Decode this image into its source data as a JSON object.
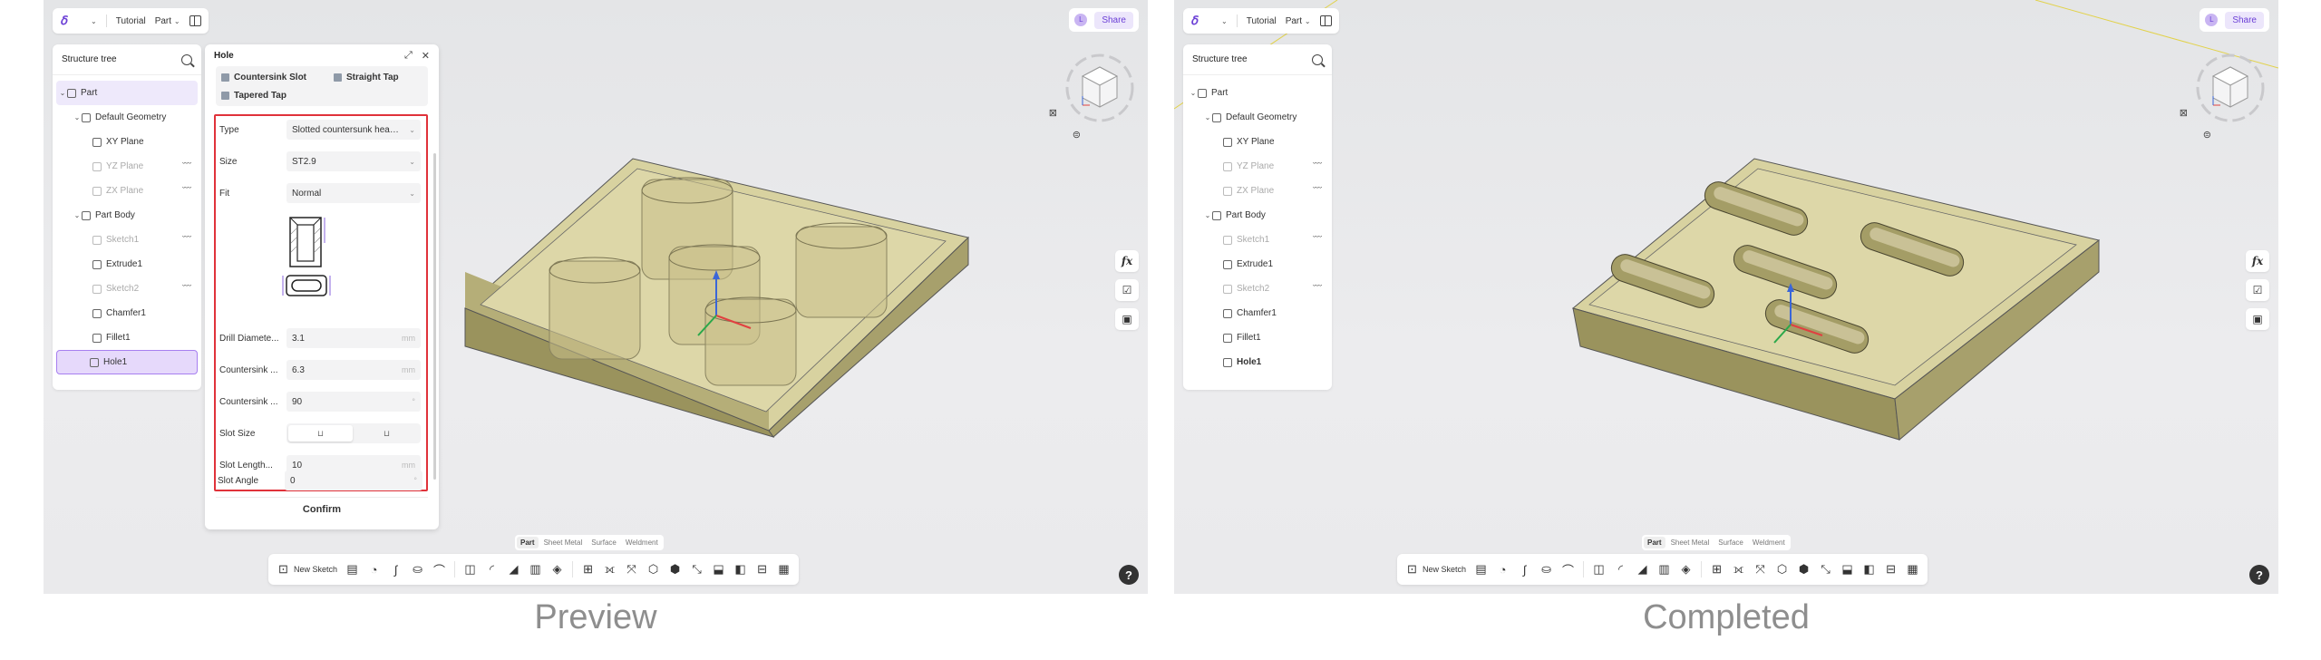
{
  "toolbar": {
    "app_logo": "ẟ",
    "breadcrumb_tutorial": "Tutorial",
    "doc_type": "Part",
    "avatar_initial": "L",
    "share_label": "Share"
  },
  "tree": {
    "title": "Structure tree",
    "items": [
      {
        "label": "Part"
      },
      {
        "label": "Default Geometry"
      },
      {
        "label": "XY Plane"
      },
      {
        "label": "YZ Plane"
      },
      {
        "label": "ZX Plane"
      },
      {
        "label": "Part Body"
      },
      {
        "label": "Sketch1"
      },
      {
        "label": "Extrude1"
      },
      {
        "label": "Sketch2"
      },
      {
        "label": "Chamfer1"
      },
      {
        "label": "Fillet1"
      },
      {
        "label": "Hole1"
      }
    ]
  },
  "hole_dialog": {
    "title": "Hole",
    "tabs": [
      "Countersink Slot",
      "Straight Tap",
      "Tapered Tap"
    ],
    "fields": {
      "type_label": "Type",
      "type_value": "Slotted countersunk head t...",
      "size_label": "Size",
      "size_value": "ST2.9",
      "fit_label": "Fit",
      "fit_value": "Normal",
      "drill_label": "Drill Diamete...",
      "drill_value": "3.1",
      "drill_unit": "mm",
      "cs_dia_label": "Countersink ...",
      "cs_dia_value": "6.3",
      "cs_dia_unit": "mm",
      "cs_angle_label": "Countersink ...",
      "cs_angle_value": "90",
      "cs_angle_unit": "°",
      "slot_size_label": "Slot Size",
      "slot_length_label": "Slot Length...",
      "slot_length_value": "10",
      "slot_length_unit": "mm",
      "slot_angle_label": "Slot Angle",
      "slot_angle_value": "0",
      "slot_angle_unit": "°"
    },
    "confirm_label": "Confirm"
  },
  "modes": [
    "Part",
    "Sheet Metal",
    "Surface",
    "Weldment"
  ],
  "bottom_toolbar": {
    "new_sketch_label": "New Sketch"
  },
  "help_label": "?",
  "fx_label": "fx",
  "captions": {
    "left": "Preview",
    "right": "Completed"
  },
  "colors": {
    "accent": "#6b3fd6",
    "highlight_border": "#e0323a",
    "model_top": "#d9d3a0",
    "model_side": "#9f9862"
  }
}
